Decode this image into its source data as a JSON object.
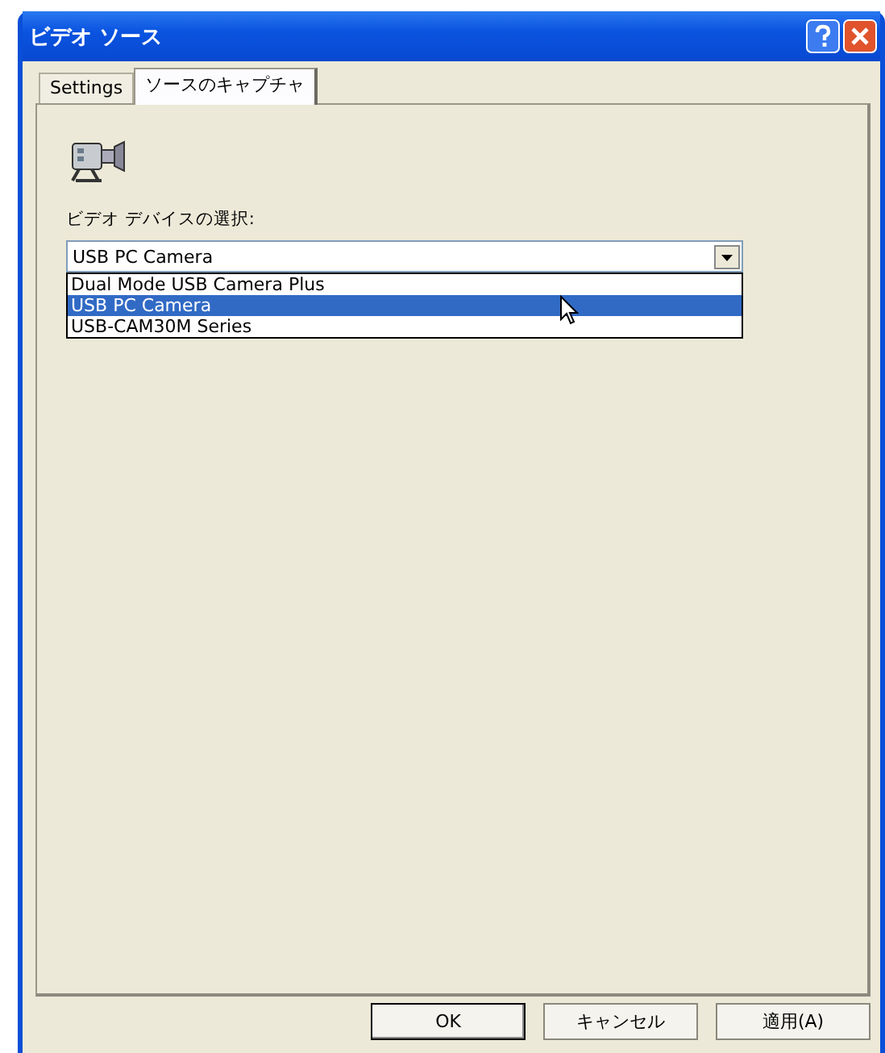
{
  "window": {
    "title": "ビデオ ソース"
  },
  "tabs": [
    {
      "label": "Settings",
      "selected": false
    },
    {
      "label": "ソースのキャプチャ",
      "selected": true
    }
  ],
  "device_select": {
    "label": "ビデオ デバイスの選択:",
    "value": "USB PC Camera",
    "options": [
      {
        "label": "Dual Mode USB Camera Plus",
        "selected": false
      },
      {
        "label": "USB PC Camera",
        "selected": true
      },
      {
        "label": "USB-CAM30M Series",
        "selected": false
      }
    ]
  },
  "buttons": [
    {
      "label": "OK",
      "kind": "default"
    },
    {
      "label": "キャンセル",
      "kind": "normal"
    },
    {
      "label": "適用(A)",
      "kind": "normal"
    }
  ]
}
